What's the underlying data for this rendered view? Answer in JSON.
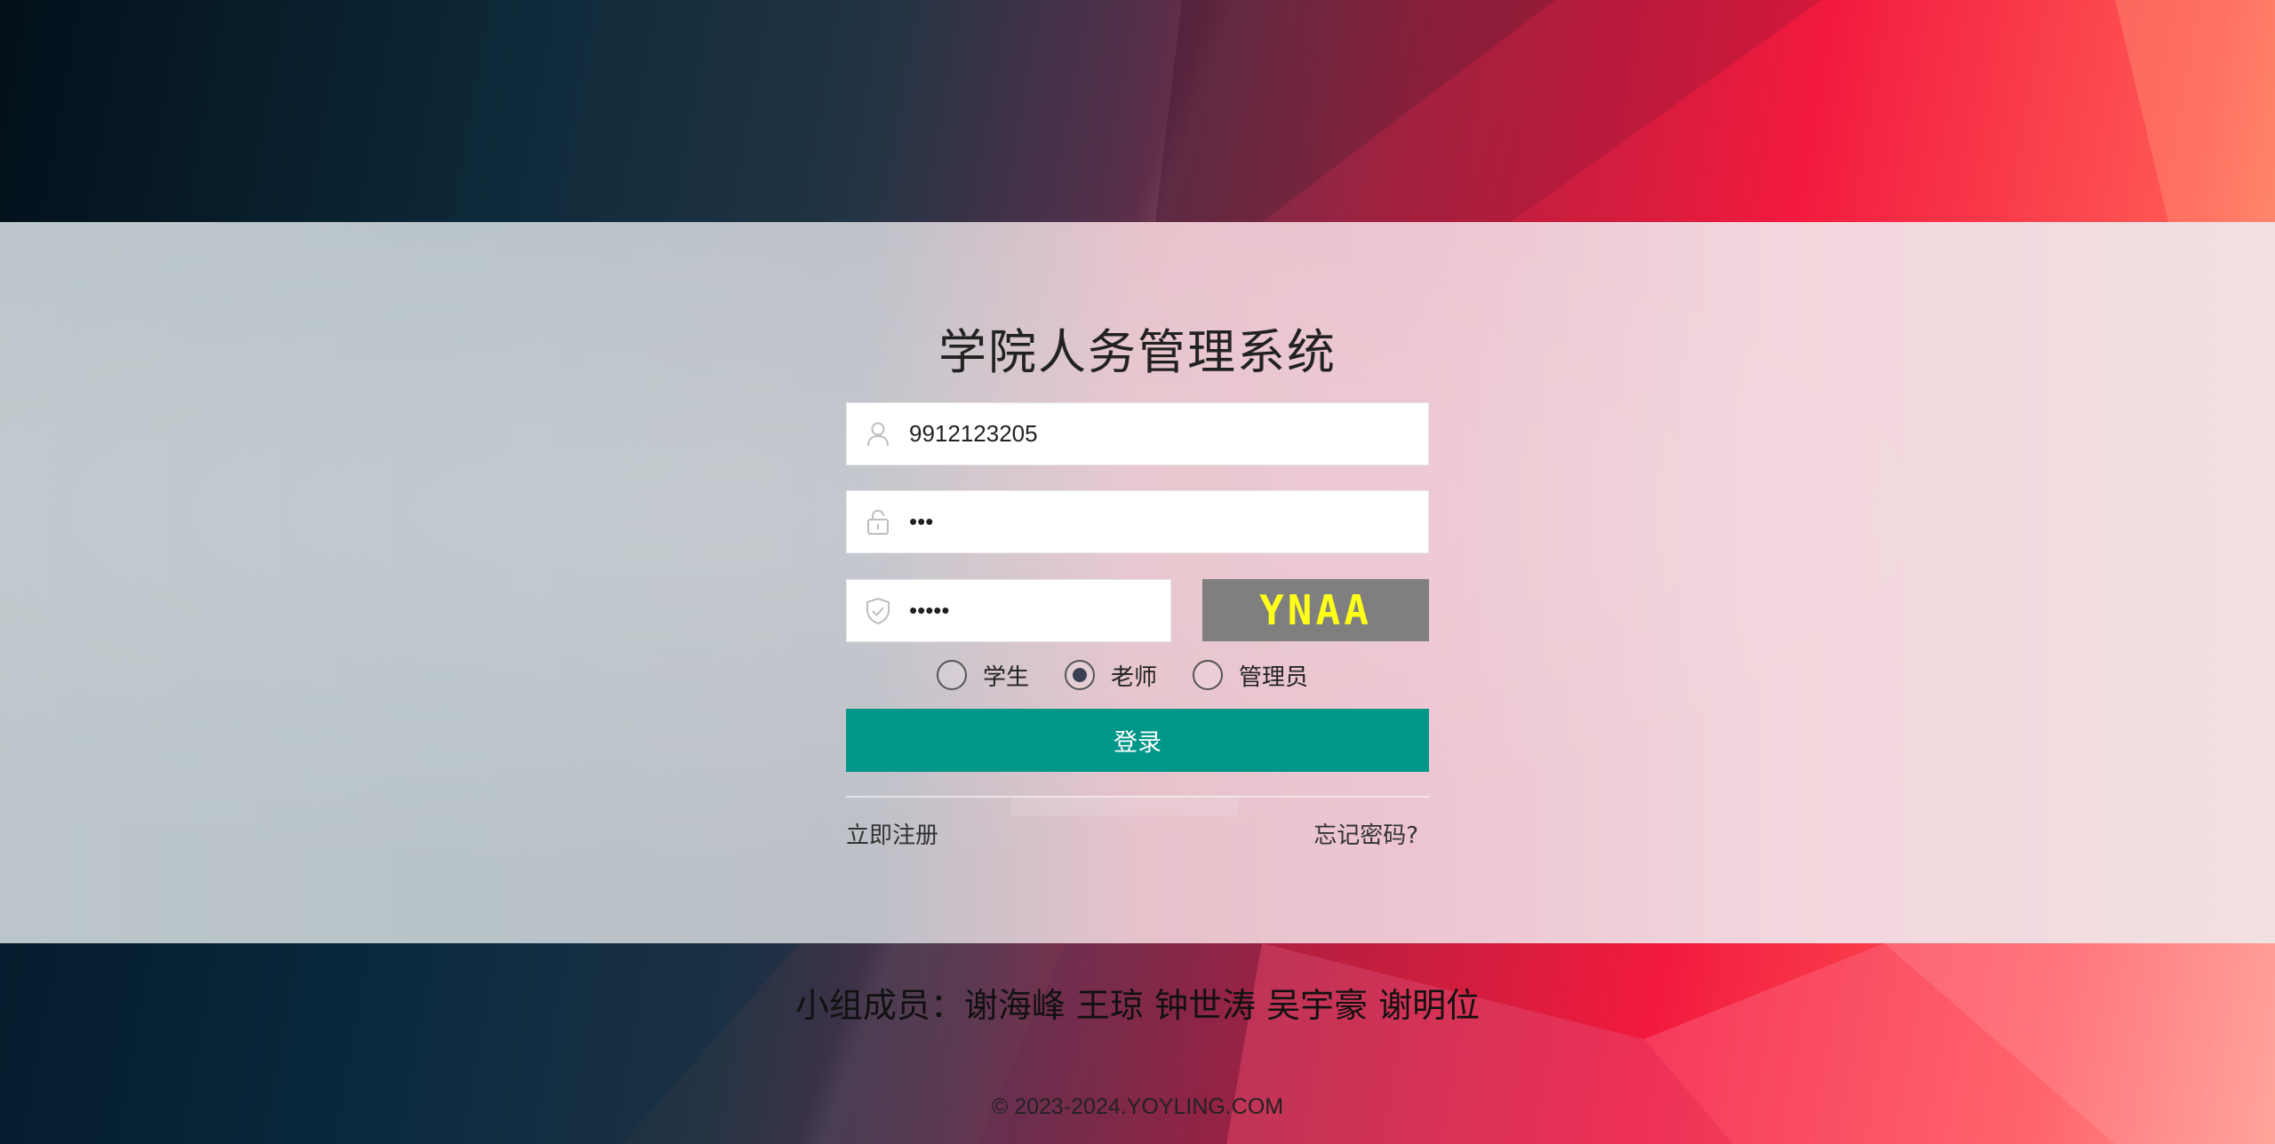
{
  "app": {
    "title": "学院人务管理系统"
  },
  "form": {
    "username_value": "9912123205",
    "password_value": "123",
    "captcha_value": "ynaaa",
    "captcha_text": "YNAA",
    "roles": [
      {
        "label": "学生",
        "selected": false
      },
      {
        "label": "老师",
        "selected": true
      },
      {
        "label": "管理员",
        "selected": false
      }
    ],
    "login_label": "登录",
    "register_label": "立即注册",
    "forgot_label": "忘记密码?"
  },
  "footer": {
    "members": "小组成员：谢海峰 王琼 钟世涛 吴宇豪 谢明位",
    "copyright": "© 2023-2024.YOYLING.COM"
  },
  "colors": {
    "login_button": "#009688",
    "captcha_bg": "#7f7f7f",
    "captcha_text": "#ffff1a"
  },
  "icons": {
    "username": "user-icon",
    "password": "lock-icon",
    "captcha": "shield-check-icon"
  }
}
